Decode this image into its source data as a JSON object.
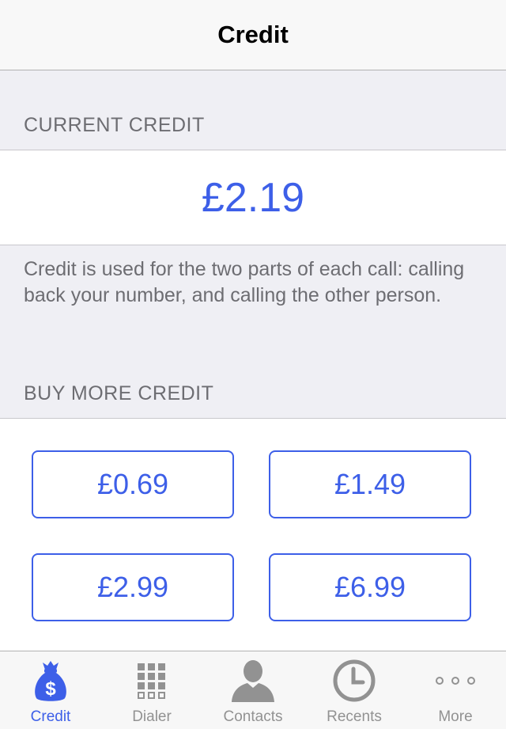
{
  "navbar": {
    "title": "Credit"
  },
  "current_credit": {
    "header": "CURRENT CREDIT",
    "value": "£2.19",
    "footer": "Credit is used for the two parts of each call: calling back your number, and calling the other person."
  },
  "buy_more": {
    "header": "BUY MORE CREDIT",
    "options": [
      "£0.69",
      "£1.49",
      "£2.99",
      "£6.99"
    ]
  },
  "tabbar": {
    "items": [
      {
        "label": "Credit",
        "icon": "money-bag-icon",
        "active": true
      },
      {
        "label": "Dialer",
        "icon": "keypad-icon",
        "active": false
      },
      {
        "label": "Contacts",
        "icon": "person-icon",
        "active": false
      },
      {
        "label": "Recents",
        "icon": "clock-icon",
        "active": false
      },
      {
        "label": "More",
        "icon": "more-dots-icon",
        "active": false
      }
    ]
  },
  "colors": {
    "accent": "#3d5fe8",
    "inactive": "#929292",
    "background": "#efeff4"
  }
}
